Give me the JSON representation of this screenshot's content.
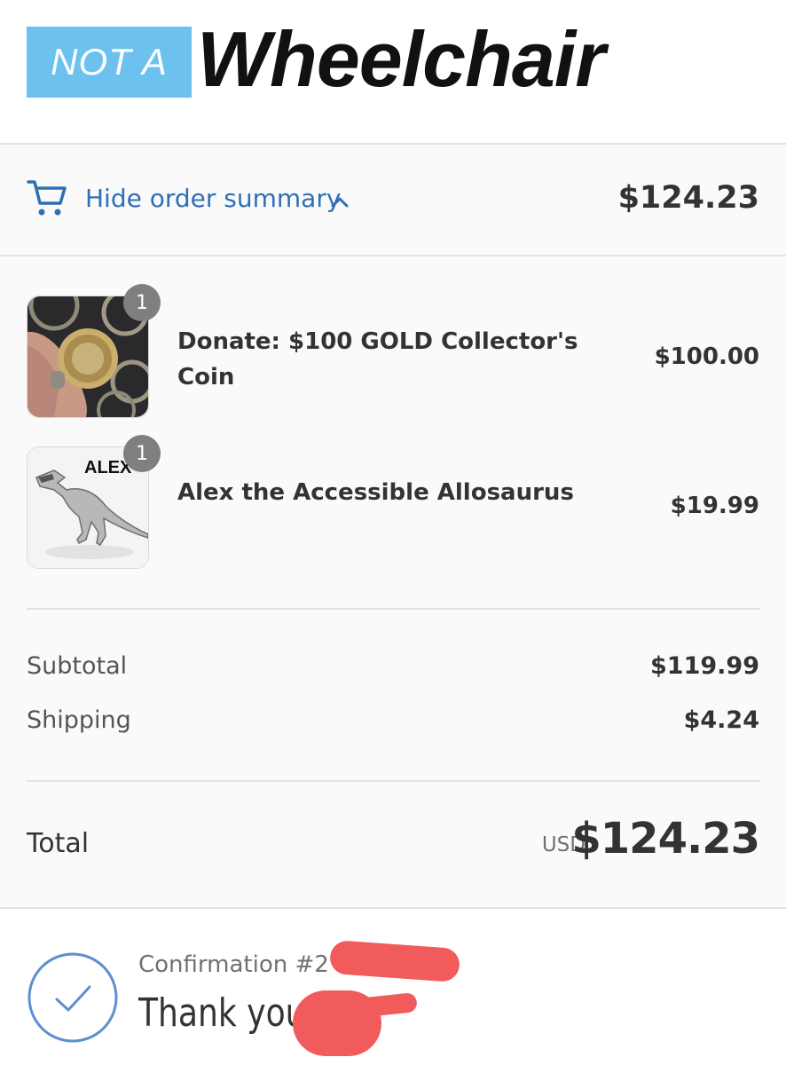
{
  "header": {
    "logo_left": "NOT A",
    "logo_right": "Wheelchair"
  },
  "summary_toggle": {
    "label": "Hide order summary",
    "total": "$124.23",
    "icon": "cart-icon",
    "chevron": "chevron-up-icon"
  },
  "products": [
    {
      "name": "Donate: $100 GOLD Collector's Coin",
      "price": "$100.00",
      "quantity": "1"
    },
    {
      "name": "Alex the Accessible Allosaurus",
      "price": "$19.99",
      "quantity": "1",
      "thumb_text": "ALEX"
    }
  ],
  "totals": {
    "subtotal_label": "Subtotal",
    "subtotal_value": "$119.99",
    "shipping_label": "Shipping",
    "shipping_value": "$4.24",
    "total_label": "Total",
    "currency": "USD",
    "total_value": "$124.23"
  },
  "confirmation": {
    "number": "Confirmation #2          MFN",
    "thank_you": "Thank you        !"
  },
  "colors": {
    "link_blue": "#2f6fb5",
    "logo_blue": "#6cc1ef",
    "badge_gray": "#7f7f7f",
    "redaction": "#f15b5b"
  }
}
